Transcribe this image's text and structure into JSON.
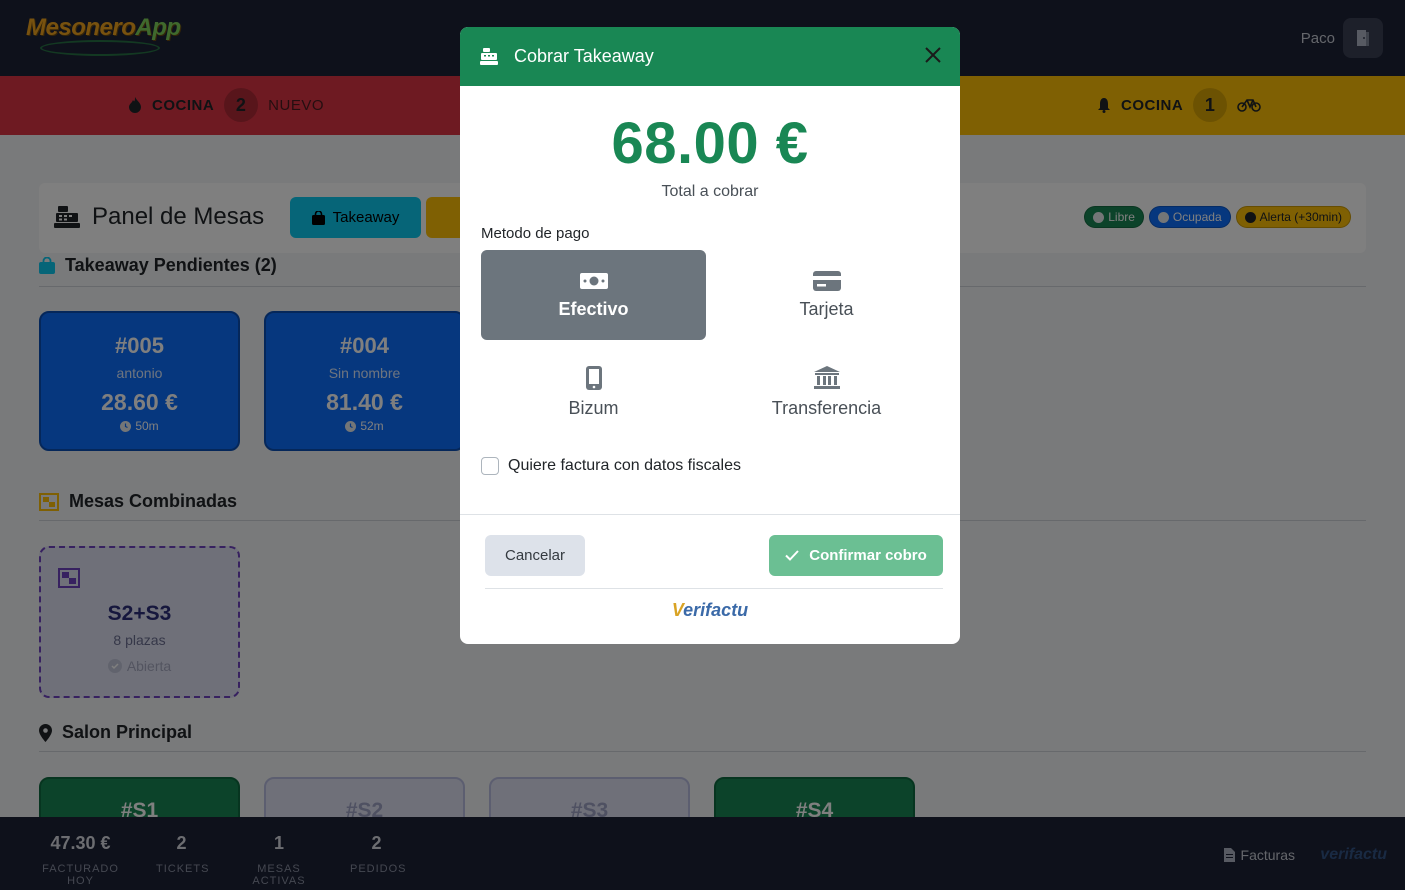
{
  "brand": {
    "name_part1": "Mesonero",
    "name_part2": "App"
  },
  "header": {
    "user": "Paco",
    "exit_icon": "door-exit-icon"
  },
  "kitchen_left": {
    "label": "COCINA",
    "count": "2",
    "status": "NUEVO",
    "icon": "fire-icon"
  },
  "kitchen_right": {
    "label": "COCINA",
    "count": "1",
    "icon": "bell-icon",
    "extra_icon": "bicycle-icon"
  },
  "panel": {
    "title": "Panel de Mesas",
    "takeaway_button": "Takeaway",
    "legend": [
      {
        "label": "Libre",
        "color": "#198754"
      },
      {
        "label": "Ocupada",
        "color": "#0d6efd"
      },
      {
        "label": "Alerta (+30min)",
        "color": "#ffc107"
      }
    ]
  },
  "takeaway": {
    "title": "Takeaway Pendientes (2)",
    "orders": [
      {
        "id": "#005",
        "name": "antonio",
        "amount": "28.60 €",
        "time": "50m"
      },
      {
        "id": "#004",
        "name": "Sin nombre",
        "amount": "81.40 €",
        "time": "52m"
      }
    ]
  },
  "combined": {
    "title": "Mesas Combinadas",
    "tables": [
      {
        "name": "S2+S3",
        "seats": "8 plazas",
        "state": "Abierta"
      }
    ]
  },
  "salon": {
    "title": "Salon Principal",
    "tables": [
      {
        "name": "#S1",
        "status": "libre"
      },
      {
        "name": "#S2",
        "status": "combinada"
      },
      {
        "name": "#S3",
        "status": "combinada"
      },
      {
        "name": "#S4",
        "status": "libre"
      }
    ]
  },
  "footer": {
    "stats": [
      {
        "value": "47.30 €",
        "label": "FACTURADO HOY"
      },
      {
        "value": "2",
        "label": "TICKETS"
      },
      {
        "value": "1",
        "label": "MESAS ACTIVAS"
      },
      {
        "value": "2",
        "label": "PEDIDOS"
      }
    ],
    "facturas": "Facturas",
    "verifactu": "verifactu"
  },
  "modal": {
    "title": "Cobrar  Takeaway",
    "total": "68.00 €",
    "total_label": "Total a cobrar",
    "method_label": "Metodo de pago",
    "methods": [
      {
        "label": "Efectivo",
        "icon": "cash-icon",
        "selected": true
      },
      {
        "label": "Tarjeta",
        "icon": "credit-card-icon",
        "selected": false
      },
      {
        "label": "Bizum",
        "icon": "phone-icon",
        "selected": false
      },
      {
        "label": "Transferencia",
        "icon": "bank-icon",
        "selected": false
      }
    ],
    "invoice_checkbox": {
      "label": "Quiere factura con datos fiscales",
      "checked": false
    },
    "cancel": "Cancelar",
    "confirm": "Confirmar cobro",
    "verifactu_v": "V",
    "verifactu_rest": "erifactu"
  }
}
